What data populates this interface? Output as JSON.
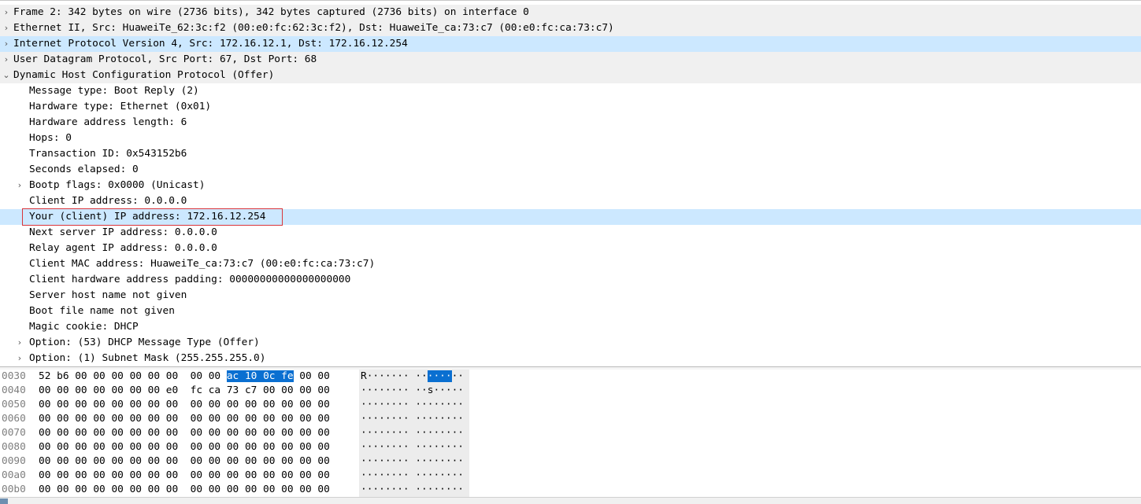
{
  "detail_tree": [
    {
      "level": 0,
      "expander": "collapsed",
      "text": "Frame 2: 342 bytes on wire (2736 bits), 342 bytes captured (2736 bits) on interface 0",
      "style": "top"
    },
    {
      "level": 0,
      "expander": "collapsed",
      "text": "Ethernet II, Src: HuaweiTe_62:3c:f2 (00:e0:fc:62:3c:f2), Dst: HuaweiTe_ca:73:c7 (00:e0:fc:ca:73:c7)",
      "style": "top"
    },
    {
      "level": 0,
      "expander": "collapsed",
      "text": "Internet Protocol Version 4, Src: 172.16.12.1, Dst: 172.16.12.254",
      "style": "sel"
    },
    {
      "level": 0,
      "expander": "collapsed",
      "text": "User Datagram Protocol, Src Port: 67, Dst Port: 68",
      "style": "top"
    },
    {
      "level": 0,
      "expander": "expanded",
      "text": "Dynamic Host Configuration Protocol (Offer)",
      "style": "top"
    },
    {
      "level": 1,
      "expander": "none",
      "text": "Message type: Boot Reply (2)",
      "style": ""
    },
    {
      "level": 1,
      "expander": "none",
      "text": "Hardware type: Ethernet (0x01)",
      "style": ""
    },
    {
      "level": 1,
      "expander": "none",
      "text": "Hardware address length: 6",
      "style": ""
    },
    {
      "level": 1,
      "expander": "none",
      "text": "Hops: 0",
      "style": ""
    },
    {
      "level": 1,
      "expander": "none",
      "text": "Transaction ID: 0x543152b6",
      "style": ""
    },
    {
      "level": 1,
      "expander": "none",
      "text": "Seconds elapsed: 0",
      "style": ""
    },
    {
      "level": 1,
      "expander": "collapsed",
      "text": "Bootp flags: 0x0000 (Unicast)",
      "style": ""
    },
    {
      "level": 1,
      "expander": "none",
      "text": "Client IP address: 0.0.0.0",
      "style": ""
    },
    {
      "level": 1,
      "expander": "none",
      "text": "Your (client) IP address: 172.16.12.254",
      "style": "focus"
    },
    {
      "level": 1,
      "expander": "none",
      "text": "Next server IP address: 0.0.0.0",
      "style": ""
    },
    {
      "level": 1,
      "expander": "none",
      "text": "Relay agent IP address: 0.0.0.0",
      "style": ""
    },
    {
      "level": 1,
      "expander": "none",
      "text": "Client MAC address: HuaweiTe_ca:73:c7 (00:e0:fc:ca:73:c7)",
      "style": ""
    },
    {
      "level": 1,
      "expander": "none",
      "text": "Client hardware address padding: 00000000000000000000",
      "style": ""
    },
    {
      "level": 1,
      "expander": "none",
      "text": "Server host name not given",
      "style": ""
    },
    {
      "level": 1,
      "expander": "none",
      "text": "Boot file name not given",
      "style": ""
    },
    {
      "level": 1,
      "expander": "none",
      "text": "Magic cookie: DHCP",
      "style": ""
    },
    {
      "level": 1,
      "expander": "collapsed",
      "text": "Option: (53) DHCP Message Type (Offer)",
      "style": ""
    },
    {
      "level": 1,
      "expander": "collapsed",
      "text": "Option: (1) Subnet Mask (255.255.255.0)",
      "style": ""
    }
  ],
  "expander_glyphs": {
    "collapsed": "›",
    "expanded": "⌄",
    "none": ""
  },
  "hex_dump": [
    {
      "offset": "0030",
      "hex_pre": "52 b6 00 00 00 00 00 00  00 00 ",
      "hex_hl": "ac 10 0c fe",
      "hex_post": " 00 00",
      "ascii_pre": "R······· ··",
      "ascii_hl": "····",
      "ascii_post": "··"
    },
    {
      "offset": "0040",
      "hex_pre": "00 00 00 00 00 00 00 e0  fc ca 73 c7 00 00 00 00",
      "hex_hl": "",
      "hex_post": "",
      "ascii_pre": "········ ··s·····",
      "ascii_hl": "",
      "ascii_post": ""
    },
    {
      "offset": "0050",
      "hex_pre": "00 00 00 00 00 00 00 00  00 00 00 00 00 00 00 00",
      "hex_hl": "",
      "hex_post": "",
      "ascii_pre": "········ ········",
      "ascii_hl": "",
      "ascii_post": ""
    },
    {
      "offset": "0060",
      "hex_pre": "00 00 00 00 00 00 00 00  00 00 00 00 00 00 00 00",
      "hex_hl": "",
      "hex_post": "",
      "ascii_pre": "········ ········",
      "ascii_hl": "",
      "ascii_post": ""
    },
    {
      "offset": "0070",
      "hex_pre": "00 00 00 00 00 00 00 00  00 00 00 00 00 00 00 00",
      "hex_hl": "",
      "hex_post": "",
      "ascii_pre": "········ ········",
      "ascii_hl": "",
      "ascii_post": ""
    },
    {
      "offset": "0080",
      "hex_pre": "00 00 00 00 00 00 00 00  00 00 00 00 00 00 00 00",
      "hex_hl": "",
      "hex_post": "",
      "ascii_pre": "········ ········",
      "ascii_hl": "",
      "ascii_post": ""
    },
    {
      "offset": "0090",
      "hex_pre": "00 00 00 00 00 00 00 00  00 00 00 00 00 00 00 00",
      "hex_hl": "",
      "hex_post": "",
      "ascii_pre": "········ ········",
      "ascii_hl": "",
      "ascii_post": ""
    },
    {
      "offset": "00a0",
      "hex_pre": "00 00 00 00 00 00 00 00  00 00 00 00 00 00 00 00",
      "hex_hl": "",
      "hex_post": "",
      "ascii_pre": "········ ········",
      "ascii_hl": "",
      "ascii_post": ""
    },
    {
      "offset": "00b0",
      "hex_pre": "00 00 00 00 00 00 00 00  00 00 00 00 00 00 00 00",
      "hex_hl": "",
      "hex_post": "",
      "ascii_pre": "········ ········",
      "ascii_hl": "",
      "ascii_post": ""
    }
  ],
  "colors": {
    "selection": "#cce8ff",
    "byte_highlight": "#0a6fd1",
    "focus_border": "#d9353a"
  }
}
